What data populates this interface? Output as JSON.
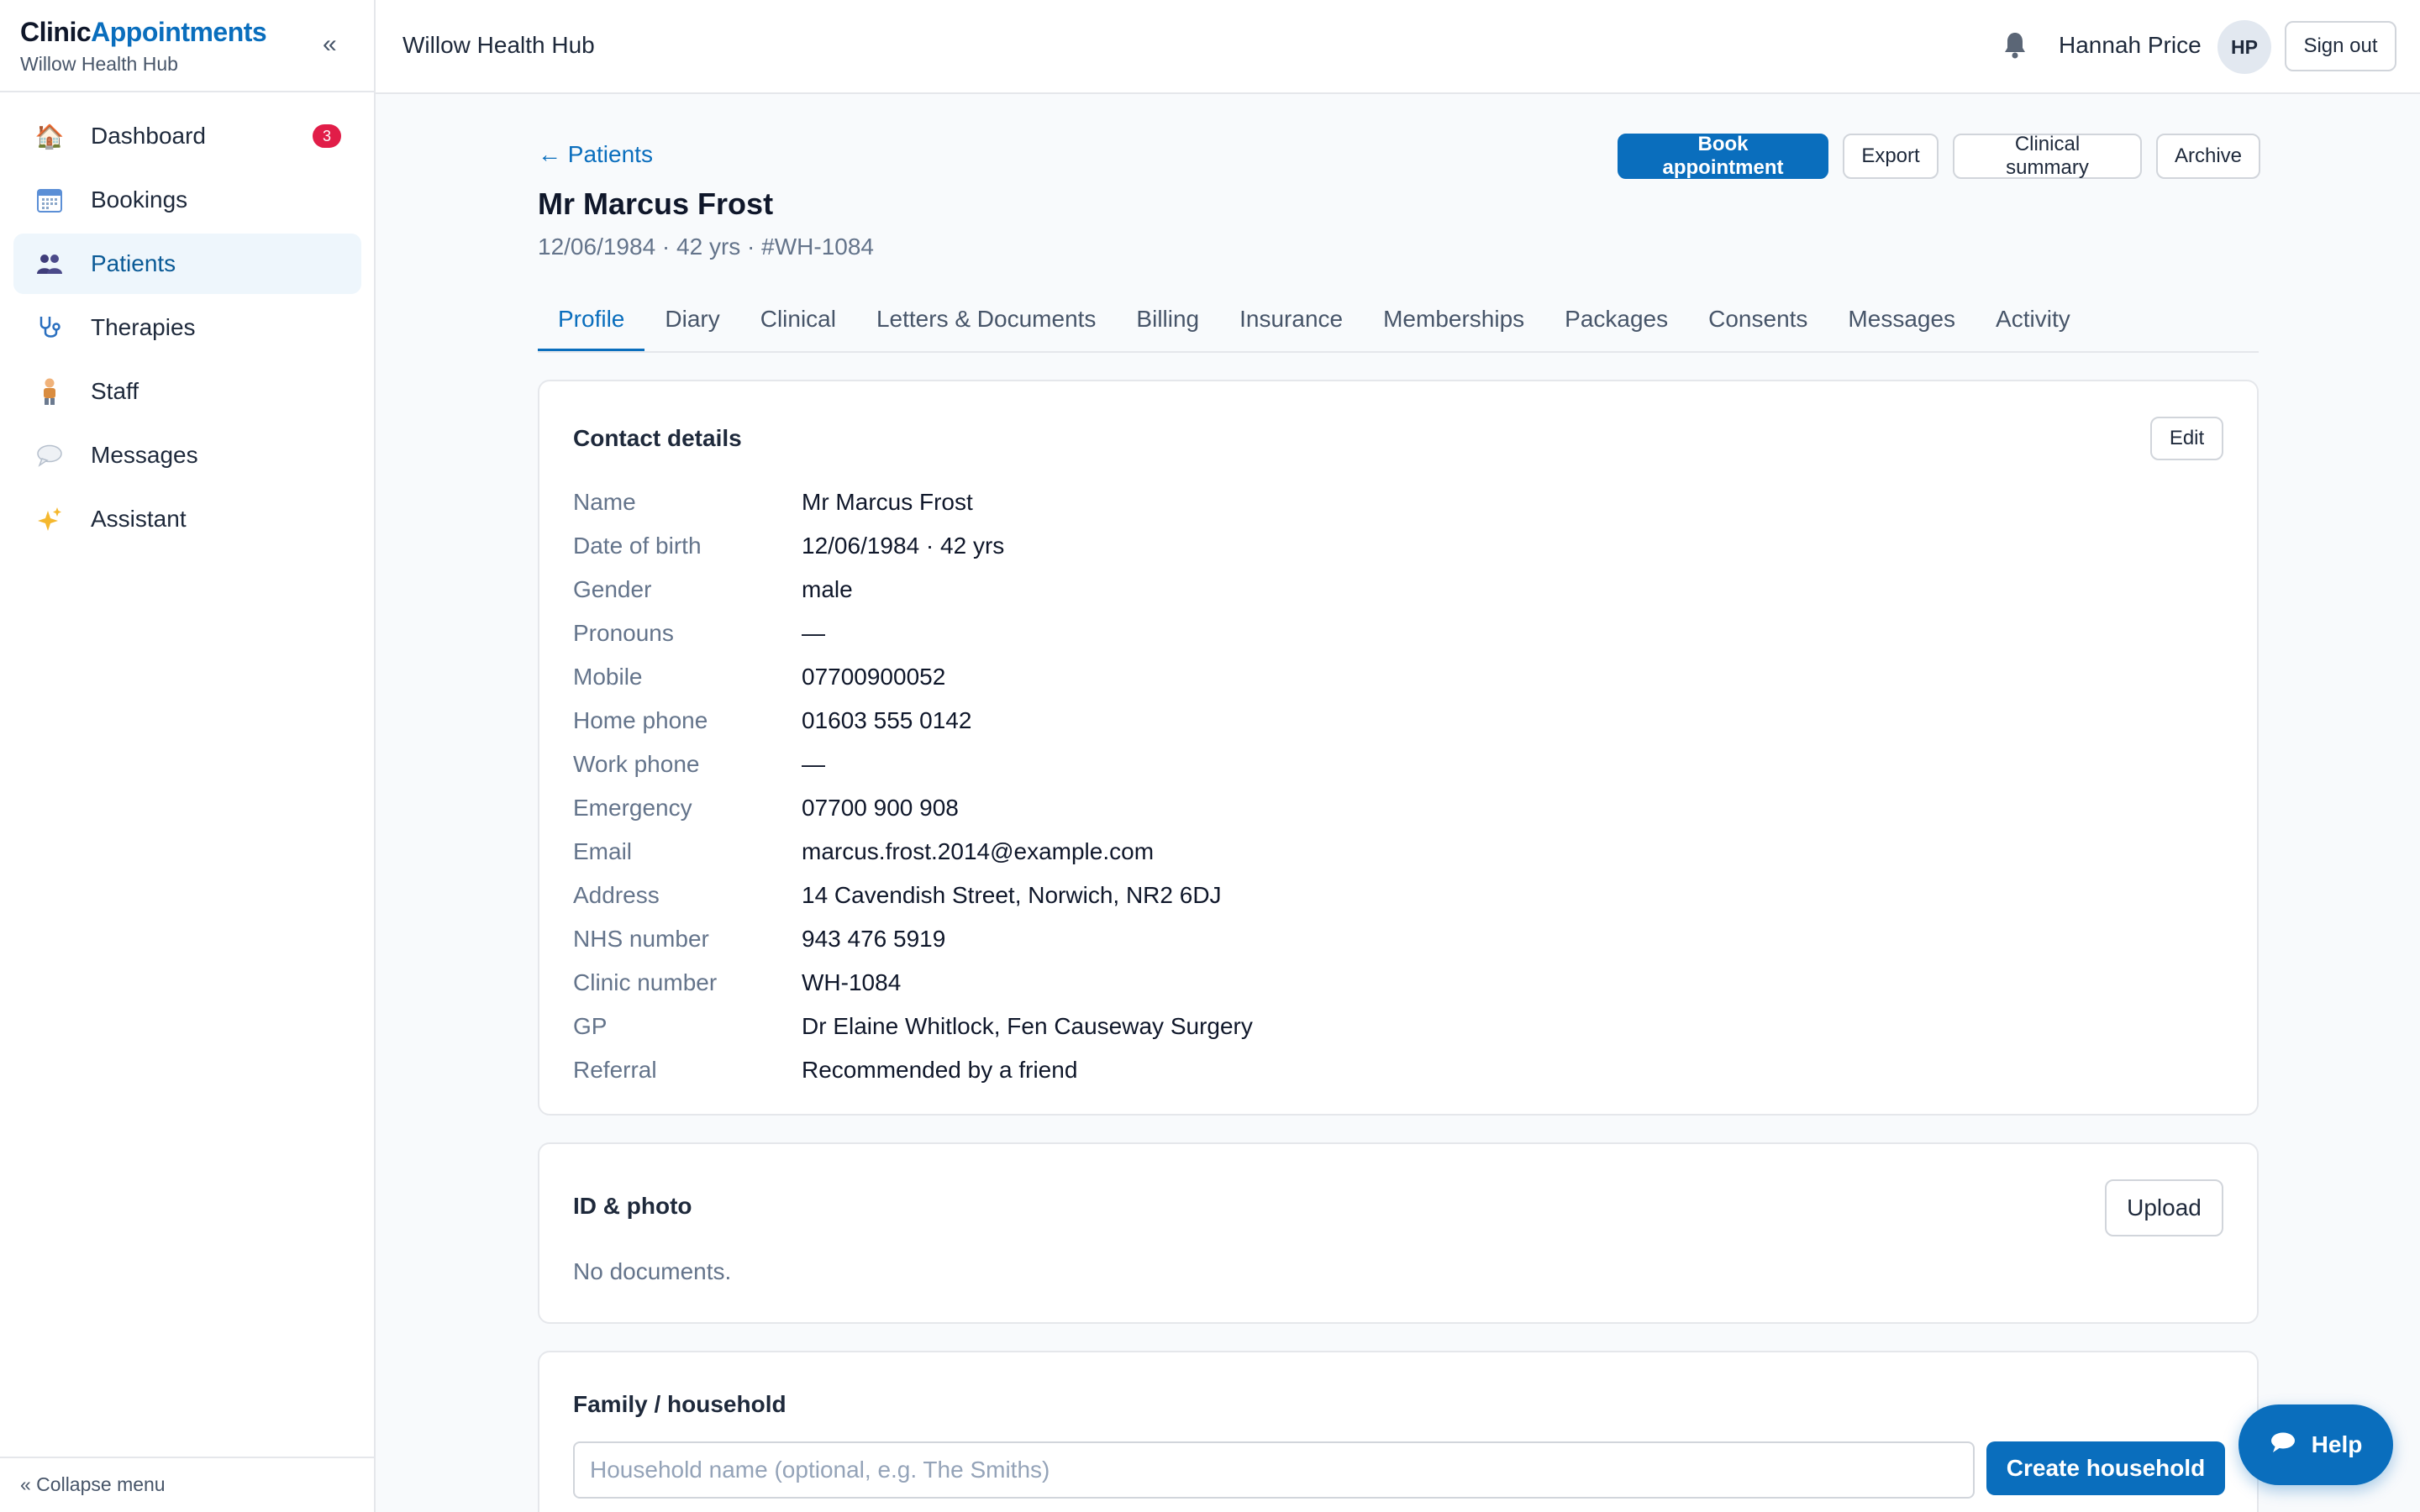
{
  "sidebar": {
    "brand_part1": "Clinic",
    "brand_part2": "Appointments",
    "org": "Willow Health Hub",
    "collapse_icon": "«",
    "items": [
      {
        "label": "Dashboard",
        "icon": "house-icon",
        "badge": "3"
      },
      {
        "label": "Bookings",
        "icon": "calendar-icon"
      },
      {
        "label": "Patients",
        "icon": "people-icon",
        "active": true
      },
      {
        "label": "Therapies",
        "icon": "stethoscope-icon"
      },
      {
        "label": "Staff",
        "icon": "person-icon"
      },
      {
        "label": "Messages",
        "icon": "speech-bubble-icon"
      },
      {
        "label": "Assistant",
        "icon": "sparkles-icon"
      }
    ],
    "footer": "«  Collapse menu"
  },
  "topbar": {
    "title": "Willow Health Hub",
    "user_name": "Hannah Price",
    "avatar_initials": "HP",
    "sign_out": "Sign out"
  },
  "patient": {
    "back_label": "← Patients",
    "name": "Mr Marcus Frost",
    "meta": "12/06/1984 · 42 yrs · #WH-1084",
    "actions": {
      "book": "Book appointment",
      "export": "Export",
      "summary": "Clinical summary",
      "archive": "Archive"
    }
  },
  "tabs": [
    "Profile",
    "Diary",
    "Clinical",
    "Letters & Documents",
    "Billing",
    "Insurance",
    "Memberships",
    "Packages",
    "Consents",
    "Messages",
    "Activity"
  ],
  "contact": {
    "title": "Contact details",
    "edit": "Edit",
    "rows": [
      {
        "label": "Name",
        "value": "Mr Marcus Frost"
      },
      {
        "label": "Date of birth",
        "value": "12/06/1984 · 42 yrs"
      },
      {
        "label": "Gender",
        "value": "male"
      },
      {
        "label": "Pronouns",
        "value": "—"
      },
      {
        "label": "Mobile",
        "value": "07700900052"
      },
      {
        "label": "Home phone",
        "value": "01603 555 0142"
      },
      {
        "label": "Work phone",
        "value": "—"
      },
      {
        "label": "Emergency",
        "value": "07700 900 908"
      },
      {
        "label": "Email",
        "value": "marcus.frost.2014@example.com"
      },
      {
        "label": "Address",
        "value": "14 Cavendish Street, Norwich, NR2 6DJ"
      },
      {
        "label": "NHS number",
        "value": "943 476 5919"
      },
      {
        "label": "Clinic number",
        "value": "WH-1084"
      },
      {
        "label": "GP",
        "value": "Dr Elaine Whitlock, Fen Causeway Surgery"
      },
      {
        "label": "Referral",
        "value": "Recommended by a friend"
      }
    ]
  },
  "id_photo": {
    "title": "ID & photo",
    "upload": "Upload",
    "empty": "No documents."
  },
  "household": {
    "title": "Family / household",
    "placeholder": "Household name (optional, e.g. The Smiths)",
    "create": "Create household"
  },
  "help": {
    "label": "Help",
    "icon": "chat-icon"
  },
  "colors": {
    "accent": "#0a6ebd",
    "badge": "#e11d48"
  }
}
